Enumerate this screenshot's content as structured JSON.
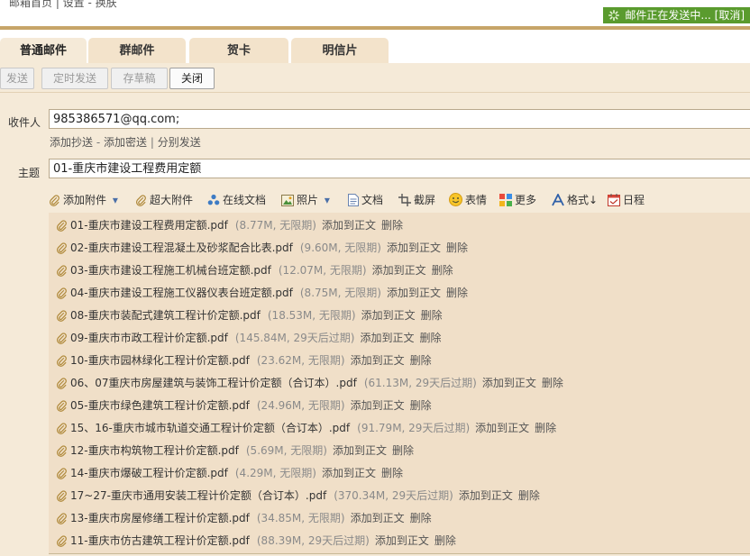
{
  "breadcrumb": "邮箱首页 | 设置 - 换肤",
  "send_status": "邮件正在发送中... [取消]",
  "tabs": [
    "普通邮件",
    "群邮件",
    "贺卡",
    "明信片"
  ],
  "toolbar": {
    "send": "发送",
    "scheduled": "定时发送",
    "draft": "存草稿",
    "close": "关闭"
  },
  "recipient": {
    "label": "收件人",
    "value": "985386571@qq.com;"
  },
  "recipient_links": {
    "cc": "添加抄送",
    "bcc": "添加密送",
    "separate": "分别发送"
  },
  "subject": {
    "label": "主题",
    "value": "01-重庆市建设工程费用定额"
  },
  "attach_toolbar": {
    "add_attachment": "添加附件",
    "large_attachment": "超大附件",
    "online_doc": "在线文档",
    "photo": "照片",
    "document": "文档",
    "screenshot": "截屏",
    "emoji": "表情",
    "more": "更多",
    "format": "格式↓",
    "schedule": "日程"
  },
  "attachment_actions": {
    "add_to_body": "添加到正文",
    "delete": "删除"
  },
  "attachments": [
    {
      "name": "01-重庆市建设工程费用定额.pdf",
      "meta": "(8.77M, 无限期)"
    },
    {
      "name": "02-重庆市建设工程混凝土及砂浆配合比表.pdf",
      "meta": "(9.60M, 无限期)"
    },
    {
      "name": "03-重庆市建设工程施工机械台班定额.pdf",
      "meta": "(12.07M, 无限期)"
    },
    {
      "name": "04-重庆市建设工程施工仪器仪表台班定额.pdf",
      "meta": "(8.75M, 无限期)"
    },
    {
      "name": "08-重庆市装配式建筑工程计价定额.pdf",
      "meta": "(18.53M, 无限期)"
    },
    {
      "name": "09-重庆市市政工程计价定额.pdf",
      "meta": "(145.84M, 29天后过期)"
    },
    {
      "name": "10-重庆市园林绿化工程计价定额.pdf",
      "meta": "(23.62M, 无限期)"
    },
    {
      "name": "06、07重庆市房屋建筑与装饰工程计价定额（合订本）.pdf",
      "meta": "(61.13M, 29天后过期)"
    },
    {
      "name": "05-重庆市绿色建筑工程计价定额.pdf",
      "meta": "(24.96M, 无限期)"
    },
    {
      "name": "15、16-重庆市城市轨道交通工程计价定额（合订本）.pdf",
      "meta": "(91.79M, 29天后过期)"
    },
    {
      "name": "12-重庆市构筑物工程计价定额.pdf",
      "meta": "(5.69M, 无限期)"
    },
    {
      "name": "14-重庆市爆破工程计价定额.pdf",
      "meta": "(4.29M, 无限期)"
    },
    {
      "name": "17~27-重庆市通用安装工程计价定额（合订本）.pdf",
      "meta": "(370.34M, 29天后过期)"
    },
    {
      "name": "13-重庆市房屋修缮工程计价定额.pdf",
      "meta": "(34.85M, 无限期)"
    },
    {
      "name": "11-重庆市仿古建筑工程计价定额.pdf",
      "meta": "(88.39M, 29天后过期)"
    }
  ],
  "colors": {
    "accent_gold": "#c7a569",
    "status_green": "#5a9b2e",
    "panel": "#f5ead8"
  },
  "icons": [
    "paperclip-icon",
    "cloud-doc-icon",
    "photo-icon",
    "doc-icon",
    "screenshot-icon",
    "emoji-icon",
    "more-icon",
    "format-icon",
    "calendar-icon",
    "spinner-icon"
  ]
}
